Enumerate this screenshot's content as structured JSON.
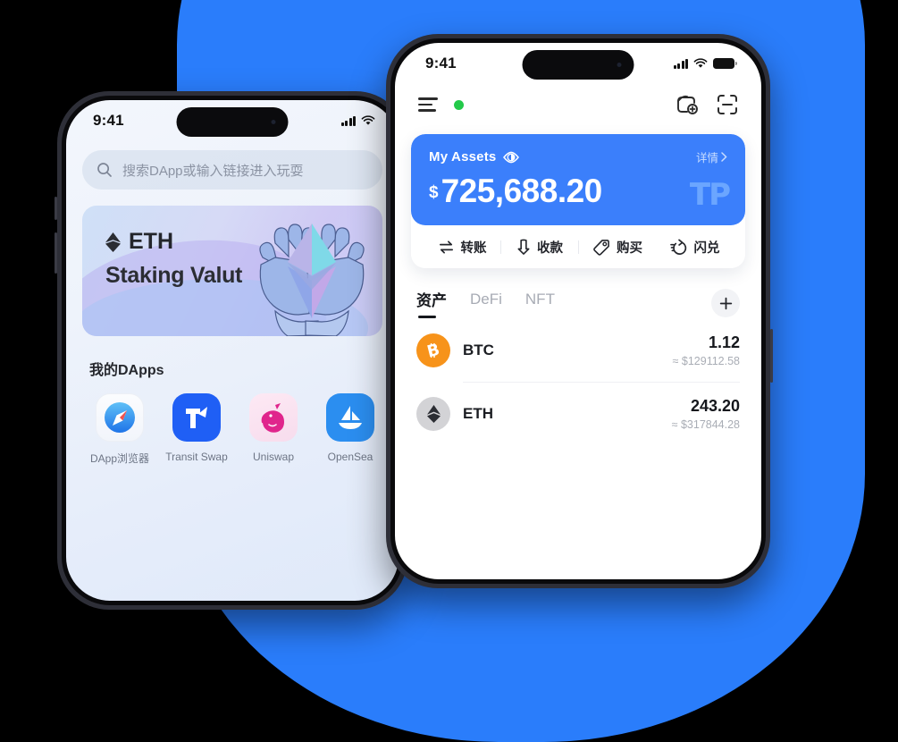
{
  "background": {
    "color": "#2a7dfb"
  },
  "left_phone": {
    "name": "dapp-browser-screen",
    "statusbar": {
      "time": "9:41",
      "signal_icon": "signal-bars-icon",
      "wifi_icon": "wifi-icon"
    },
    "search": {
      "icon": "search-icon",
      "placeholder": "搜索DApp或输入链接进入玩耍",
      "value": ""
    },
    "banner": {
      "chain_icon": "ethereum-diamond-icon",
      "chain": "ETH",
      "title": "Staking Valut",
      "art": "hands-holding-ethereum-illustration"
    },
    "dapps": {
      "section_title": "我的DApps",
      "items": [
        {
          "label": "DApp浏览器",
          "icon": "compass-icon"
        },
        {
          "label": "Transit Swap",
          "icon": "transit-swap-logo"
        },
        {
          "label": "Uniswap",
          "icon": "unicorn-icon"
        },
        {
          "label": "OpenSea",
          "icon": "sailboat-icon"
        }
      ]
    }
  },
  "right_phone": {
    "name": "wallet-home-screen",
    "statusbar": {
      "time": "9:41",
      "signal_icon": "signal-bars-icon",
      "wifi_icon": "wifi-icon",
      "battery_icon": "battery-icon"
    },
    "topbar": {
      "menu_icon": "hamburger-menu-icon",
      "network_status": "online",
      "network_color": "#23c94a",
      "wallet_add_icon": "wallet-add-icon",
      "scan_icon": "scan-qr-icon"
    },
    "assets_card": {
      "title": "My Assets",
      "eye_icon": "eye-visible-icon",
      "detail_label": "详情",
      "chevron_icon": "chevron-right-icon",
      "currency": "$",
      "amount": "725,688.20",
      "watermark": "TP",
      "card_color": "#3b7ffb"
    },
    "actions": [
      {
        "label": "转账",
        "icon": "transfer-arrows-icon"
      },
      {
        "label": "收款",
        "icon": "arrow-down-receive-icon"
      },
      {
        "label": "购买",
        "icon": "price-tag-icon"
      },
      {
        "label": "闪兑",
        "icon": "flash-swap-icon"
      }
    ],
    "tabs": [
      {
        "label": "资产",
        "active": true
      },
      {
        "label": "DeFi",
        "active": false
      },
      {
        "label": "NFT",
        "active": false
      }
    ],
    "add_token_icon": "plus-icon",
    "assets": [
      {
        "symbol": "BTC",
        "amount": "1.12",
        "fiat": "≈ $129112.58",
        "icon": "bitcoin-icon",
        "color": "#f7931a"
      },
      {
        "symbol": "ETH",
        "amount": "243.20",
        "fiat": "≈ $317844.28",
        "icon": "ethereum-icon",
        "color": "#d3d3d6"
      }
    ]
  }
}
